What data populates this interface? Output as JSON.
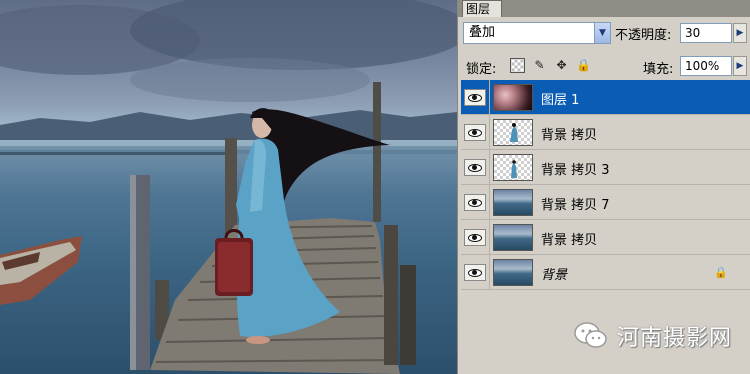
{
  "panel": {
    "tab_label": "图层",
    "blend_mode": "叠加",
    "opacity_label": "不透明度:",
    "opacity_value": "30",
    "lock_label": "锁定:",
    "fill_label": "填充:",
    "fill_value": "100%"
  },
  "layers": [
    {
      "name": "图层 1",
      "selected": true,
      "thumb": "gradient-fill"
    },
    {
      "name": "背景 拷贝",
      "selected": false,
      "thumb": "transparent-figure"
    },
    {
      "name": "背景 拷贝 3",
      "selected": false,
      "thumb": "transparent-figure"
    },
    {
      "name": "背景 拷贝 7",
      "selected": false,
      "thumb": "photo"
    },
    {
      "name": "背景 拷贝",
      "selected": false,
      "thumb": "photo"
    },
    {
      "name": "背景",
      "selected": false,
      "thumb": "photo",
      "locked": true
    }
  ],
  "watermark": {
    "text": "河南摄影网"
  },
  "icons": {
    "eye": "eye-icon",
    "lock": "lock-icon",
    "dropdown": "chevron-down-icon",
    "stepper": "chevron-right-icon",
    "lock_transparent": "checkerboard-icon",
    "lock_image": "brush-icon",
    "lock_position": "move-icon",
    "lock_all": "lock-icon"
  }
}
